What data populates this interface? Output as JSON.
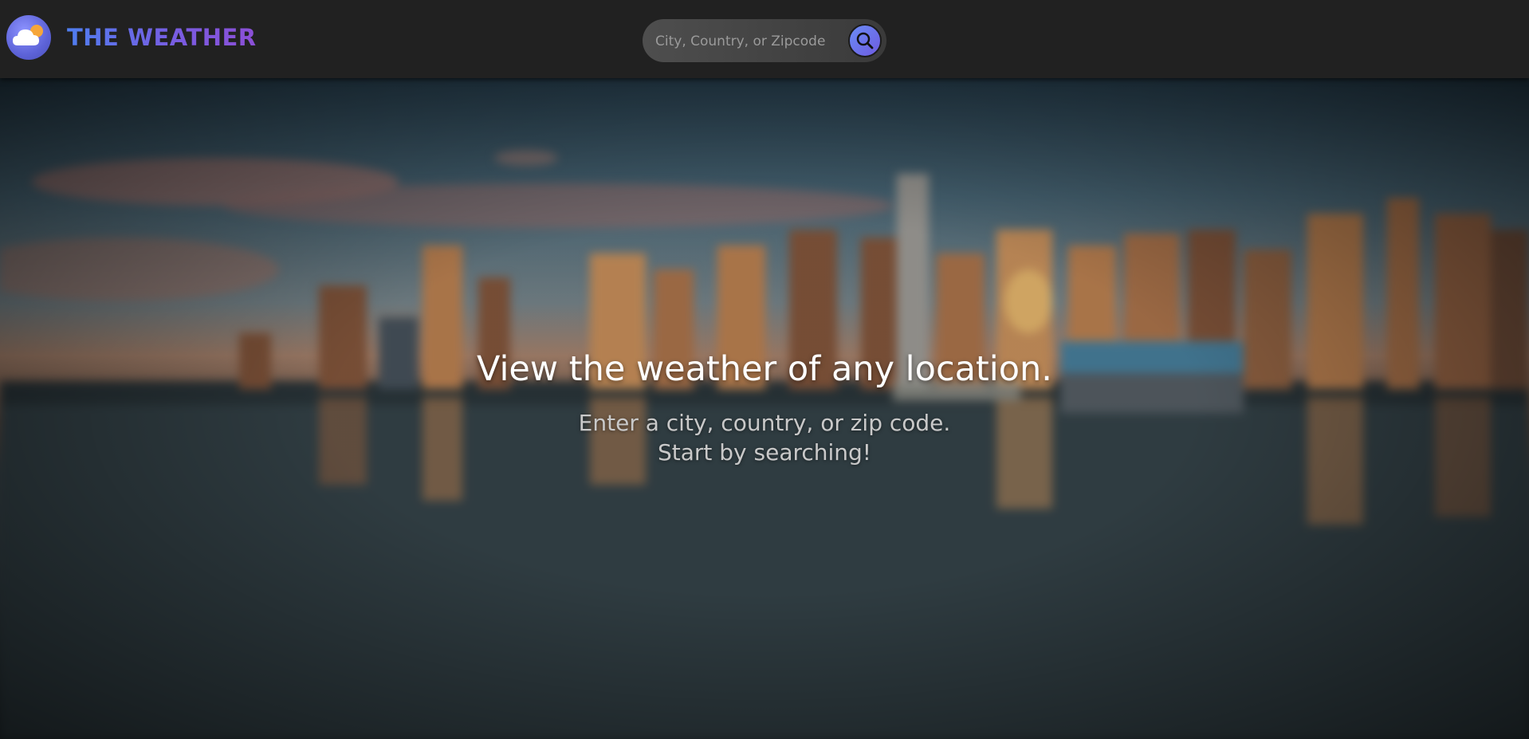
{
  "header": {
    "brand": "THE WEATHER",
    "logo_icon": "cloud-sun-icon",
    "search": {
      "placeholder": "City, Country, or Zipcode",
      "value": "",
      "button_icon": "search-icon"
    }
  },
  "hero": {
    "headline": "View the weather of any location.",
    "subtitle_line1": "Enter a city, country, or zip code.",
    "subtitle_line2": "Start by searching!"
  },
  "colors": {
    "topbar": "#212121",
    "brand_gradient_start": "#4f7ef0",
    "brand_gradient_end": "#8b4fd6",
    "search_button": "#6a8cf6"
  }
}
